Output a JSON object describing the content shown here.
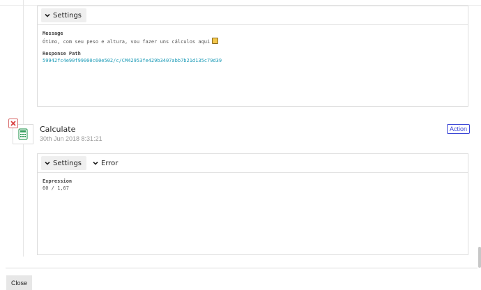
{
  "top_panel": {
    "tabs": [
      {
        "label": "Settings"
      }
    ],
    "message_label": "Message",
    "message_value": "Ótimo, com seu peso e altura, vou fazer uns cálculos aqui",
    "response_path_label": "Response Path",
    "response_path_value": "59942fc4e90f99000c60e502/c/CM42953fe429b3407abb7b21d135c79d39"
  },
  "step": {
    "title": "Calculate",
    "timestamp": "30th Jun 2018 8:31:21",
    "type_badge": "Action",
    "icon": "calculator-icon",
    "status_icon": "error-x-icon"
  },
  "bottom_panel": {
    "tabs": [
      {
        "label": "Settings"
      },
      {
        "label": "Error"
      }
    ],
    "expression_label": "Expression",
    "expression_value": "60 / 1,67"
  },
  "footer": {
    "close_label": "Close"
  },
  "colors": {
    "link": "#1a9ab6",
    "action_badge": "#3b46d6",
    "error_badge": "#d86a6a",
    "calculator": "#3aa060"
  }
}
